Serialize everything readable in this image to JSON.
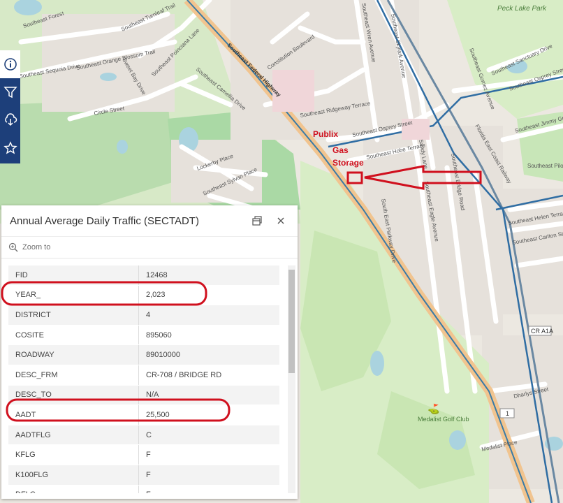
{
  "map": {
    "streets": [
      "Southeast Forest",
      "Southeast Turnleaf Trail",
      "Southeast Sequoia Drive",
      "Southeast Orange Blossom Trail",
      "Southeast Poinciana Lane",
      "Sweet Bay Drive",
      "Southeast Camellia Drive",
      "Circle Street",
      "Southeast Federal Highway",
      "Constitution Boulevard",
      "Southeast Ridgeway Terrace",
      "Southeast Osprey Street",
      "Southeast Hobe Terrace",
      "Lockerby Place",
      "Southeast Sylvan Place",
      "South East Parkway Drive",
      "Southeast Gomez Avenue",
      "Southeast Sanctuary Drive",
      "Southeast Osprey Street",
      "Southeast Jimmy Graham",
      "Southeast Pilots Cove",
      "Southeast Helen Terrace",
      "Southeast Carlton Street",
      "Dharlys Street",
      "Medalist Place",
      "Florida East Coast Railway",
      "Southeast Skylark Avenue",
      "Southeast Wren Avenue",
      "Sandy Lane",
      "Southeast Bridge Road",
      "Southeast Eagle Avenue"
    ],
    "places": [
      "Peck Lake Park",
      "Medalist Golf Club"
    ],
    "route_shield": "CR A1A",
    "route_shield2": "1"
  },
  "annotations": {
    "publix": "Publix",
    "gas": "Gas",
    "storage": "Storage"
  },
  "toolbar": [
    "info-icon",
    "filter-icon",
    "cloud-download-icon",
    "star-icon"
  ],
  "popup": {
    "title": "Annual Average Daily Traffic (SECTADT)",
    "zoom_label": "Zoom to",
    "fields": [
      {
        "name": "FID",
        "value": "12468"
      },
      {
        "name": "YEAR_",
        "value": "2,023"
      },
      {
        "name": "DISTRICT",
        "value": "4"
      },
      {
        "name": "COSITE",
        "value": "895060"
      },
      {
        "name": "ROADWAY",
        "value": "89010000"
      },
      {
        "name": "DESC_FRM",
        "value": "CR-708 / BRIDGE RD"
      },
      {
        "name": "DESC_TO",
        "value": "N/A"
      },
      {
        "name": "AADT",
        "value": "25,500"
      },
      {
        "name": "AADTFLG",
        "value": "C"
      },
      {
        "name": "KFLG",
        "value": "F"
      },
      {
        "name": "K100FLG",
        "value": "F"
      },
      {
        "name": "DFLG",
        "value": "F"
      }
    ]
  },
  "colors": {
    "toolbar": "#1d3f7a",
    "highlight": "#d0101e",
    "park": "#d8edc6",
    "forest": "#aad9a5"
  }
}
